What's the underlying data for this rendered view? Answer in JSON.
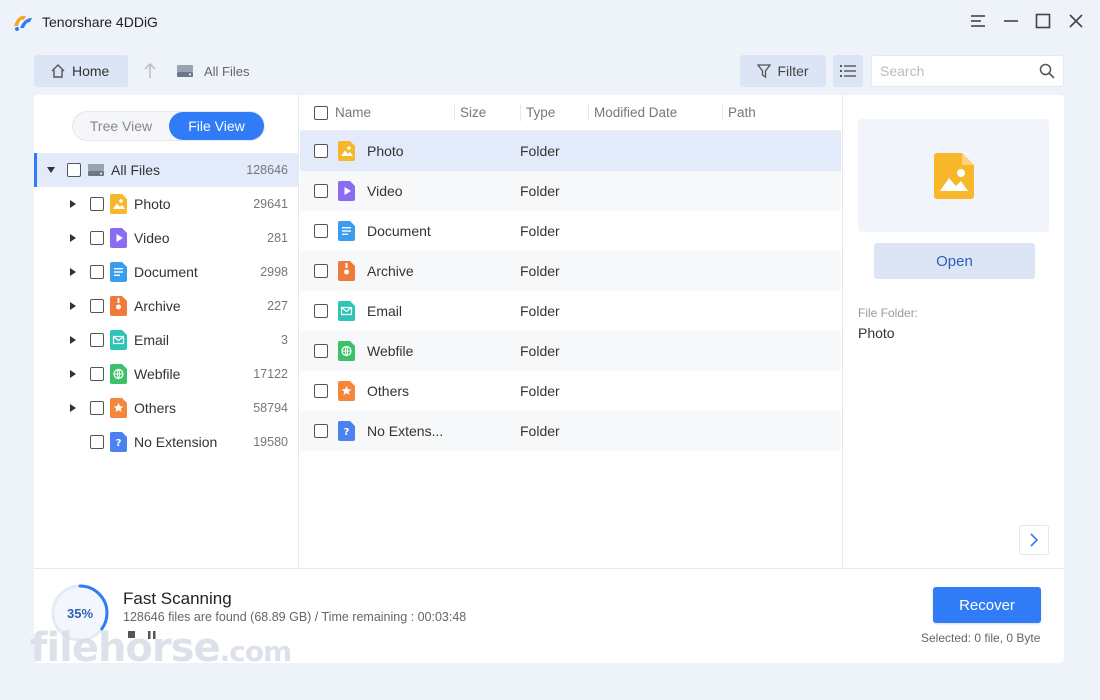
{
  "app": {
    "title": "Tenorshare 4DDiG"
  },
  "toolbar": {
    "home_label": "Home",
    "breadcrumb": "All Files",
    "filter_label": "Filter",
    "search_placeholder": "Search"
  },
  "left": {
    "toggle_tree": "Tree View",
    "toggle_file": "File View",
    "root": {
      "label": "All Files",
      "count": "128646"
    },
    "items": [
      {
        "label": "Photo",
        "count": "29641",
        "icon": "image-icon",
        "color": "#f8b62b"
      },
      {
        "label": "Video",
        "count": "281",
        "icon": "video-icon",
        "color": "#8a6cf2"
      },
      {
        "label": "Document",
        "count": "2998",
        "icon": "document-icon",
        "color": "#3a9ef0"
      },
      {
        "label": "Archive",
        "count": "227",
        "icon": "archive-icon",
        "color": "#f07a3a"
      },
      {
        "label": "Email",
        "count": "3",
        "icon": "email-icon",
        "color": "#2ec4b6"
      },
      {
        "label": "Webfile",
        "count": "17122",
        "icon": "globe-icon",
        "color": "#3cc06a"
      },
      {
        "label": "Others",
        "count": "58794",
        "icon": "star-icon",
        "color": "#f5873a"
      },
      {
        "label": "No Extension",
        "count": "19580",
        "icon": "question-icon",
        "color": "#4b82f0"
      }
    ]
  },
  "table": {
    "headers": {
      "name": "Name",
      "size": "Size",
      "type": "Type",
      "modified": "Modified Date",
      "path": "Path"
    },
    "rows": [
      {
        "name": "Photo",
        "type": "Folder"
      },
      {
        "name": "Video",
        "type": "Folder"
      },
      {
        "name": "Document",
        "type": "Folder"
      },
      {
        "name": "Archive",
        "type": "Folder"
      },
      {
        "name": "Email",
        "type": "Folder"
      },
      {
        "name": "Webfile",
        "type": "Folder"
      },
      {
        "name": "Others",
        "type": "Folder"
      },
      {
        "name": "No Extens...",
        "type": "Folder"
      }
    ]
  },
  "preview": {
    "open_label": "Open",
    "folder_label": "File Folder:",
    "folder_value": "Photo"
  },
  "scan": {
    "percent": "35%",
    "progress": 0.35,
    "title": "Fast Scanning",
    "info": "128646 files are found (68.89 GB) /  Time remaining : 00:03:48"
  },
  "footer": {
    "recover_label": "Recover",
    "selected_info": "Selected: 0 file, 0 Byte"
  },
  "watermark": {
    "main": "filehorse",
    "suffix": ".com"
  },
  "colors": {
    "accent": "#2f7cf6",
    "selected_row": "#e3ebfa",
    "button_bg": "#dce5f5"
  }
}
